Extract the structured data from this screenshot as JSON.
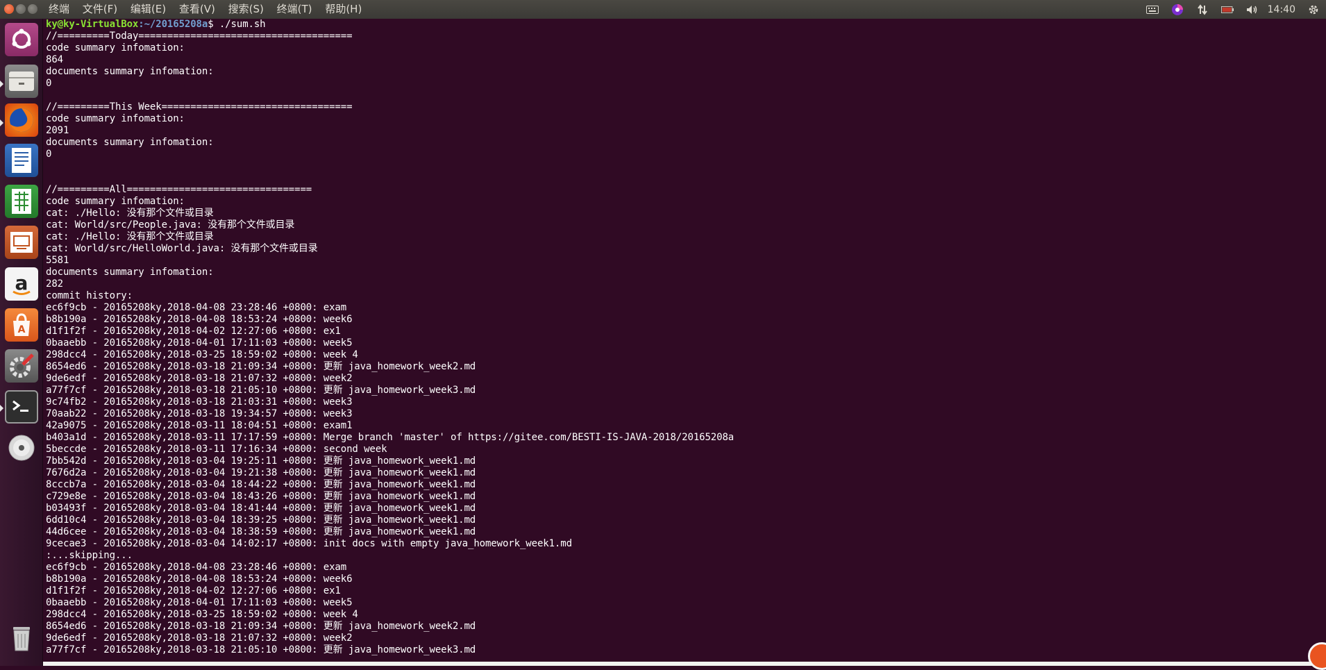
{
  "menu": [
    "终端",
    "文件(F)",
    "编辑(E)",
    "查看(V)",
    "搜索(S)",
    "终端(T)",
    "帮助(H)"
  ],
  "clock": "14:40",
  "prompt": {
    "user_host": "ky@ky-VirtualBox",
    "path": ":~/20165208a",
    "cmd": "$ ./sum.sh"
  },
  "lines": [
    "//=========Today=====================================",
    "code summary infomation:",
    "864",
    "documents summary infomation:",
    "0",
    "",
    "//=========This Week=================================",
    "code summary infomation:",
    "2091",
    "documents summary infomation:",
    "0",
    "",
    "",
    "//=========All================================",
    "code summary infomation:",
    "cat: ./Hello: 没有那个文件或目录",
    "cat: World/src/People.java: 没有那个文件或目录",
    "cat: ./Hello: 没有那个文件或目录",
    "cat: World/src/HelloWorld.java: 没有那个文件或目录",
    "5581",
    "documents summary infomation:",
    "282",
    "commit history:",
    "ec6f9cb - 20165208ky,2018-04-08 23:28:46 +0800: exam",
    "b8b190a - 20165208ky,2018-04-08 18:53:24 +0800: week6",
    "d1f1f2f - 20165208ky,2018-04-02 12:27:06 +0800: ex1",
    "0baaebb - 20165208ky,2018-04-01 17:11:03 +0800: week5",
    "298dcc4 - 20165208ky,2018-03-25 18:59:02 +0800: week 4",
    "8654ed6 - 20165208ky,2018-03-18 21:09:34 +0800: 更新 java_homework_week2.md",
    "9de6edf - 20165208ky,2018-03-18 21:07:32 +0800: week2",
    "a77f7cf - 20165208ky,2018-03-18 21:05:10 +0800: 更新 java_homework_week3.md",
    "9c74fb2 - 20165208ky,2018-03-18 21:03:31 +0800: week3",
    "70aab22 - 20165208ky,2018-03-18 19:34:57 +0800: week3",
    "42a9075 - 20165208ky,2018-03-11 18:04:51 +0800: exam1",
    "b403a1d - 20165208ky,2018-03-11 17:17:59 +0800: Merge branch 'master' of https://gitee.com/BESTI-IS-JAVA-2018/20165208a",
    "5beccde - 20165208ky,2018-03-11 17:16:34 +0800: second week",
    "7bb542d - 20165208ky,2018-03-04 19:25:11 +0800: 更新 java_homework_week1.md",
    "7676d2a - 20165208ky,2018-03-04 19:21:38 +0800: 更新 java_homework_week1.md",
    "8cccb7a - 20165208ky,2018-03-04 18:44:22 +0800: 更新 java_homework_week1.md",
    "c729e8e - 20165208ky,2018-03-04 18:43:26 +0800: 更新 java_homework_week1.md",
    "b03493f - 20165208ky,2018-03-04 18:41:44 +0800: 更新 java_homework_week1.md",
    "6dd10c4 - 20165208ky,2018-03-04 18:39:25 +0800: 更新 java_homework_week1.md",
    "44d6cee - 20165208ky,2018-03-04 18:38:59 +0800: 更新 java_homework_week1.md",
    "9cecae3 - 20165208ky,2018-03-04 14:02:17 +0800: init docs with empty java_homework_week1.md",
    ":...skipping...",
    "ec6f9cb - 20165208ky,2018-04-08 23:28:46 +0800: exam",
    "b8b190a - 20165208ky,2018-04-08 18:53:24 +0800: week6",
    "d1f1f2f - 20165208ky,2018-04-02 12:27:06 +0800: ex1",
    "0baaebb - 20165208ky,2018-04-01 17:11:03 +0800: week5",
    "298dcc4 - 20165208ky,2018-03-25 18:59:02 +0800: week 4",
    "8654ed6 - 20165208ky,2018-03-18 21:09:34 +0800: 更新 java_homework_week2.md",
    "9de6edf - 20165208ky,2018-03-18 21:07:32 +0800: week2",
    "a77f7cf - 20165208ky,2018-03-18 21:05:10 +0800: 更新 java_homework_week3.md"
  ],
  "colors": {
    "terminal_bg": "#300a24",
    "prompt_user": "#8ae234",
    "prompt_path": "#729fcf",
    "topbar": "#3c3b37",
    "accent": "#e95420"
  },
  "tray_icons": [
    "keyboard-icon",
    "app-indicator-icon",
    "network-transfer-icon",
    "battery-icon",
    "volume-icon",
    "settings-gear-icon"
  ],
  "launcher_icons": [
    "ubuntu-dash-icon",
    "files-icon",
    "firefox-icon",
    "writer-icon",
    "calc-icon",
    "impress-icon",
    "amazon-icon",
    "software-center-icon",
    "system-settings-icon",
    "terminal-icon",
    "dvd-icon",
    "trash-icon"
  ]
}
